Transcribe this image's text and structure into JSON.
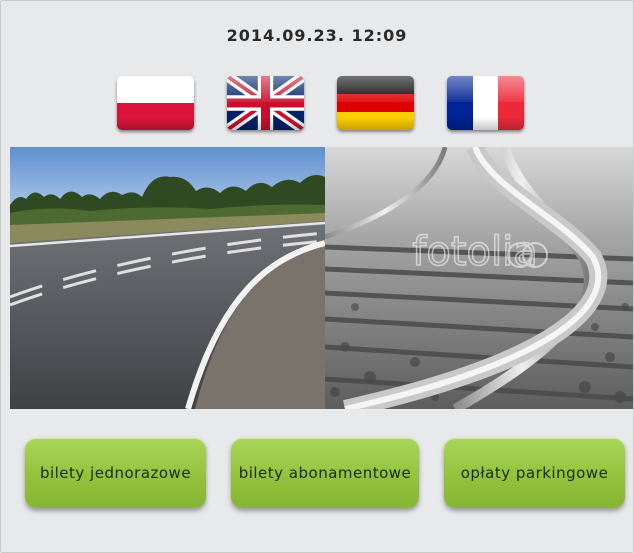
{
  "header": {
    "datetime": "2014.09.23. 12:09"
  },
  "languages": [
    {
      "code": "pl",
      "icon": "poland-flag-icon",
      "colors": [
        "#ffffff",
        "#dc143c"
      ]
    },
    {
      "code": "en",
      "icon": "uk-flag-icon",
      "colors": [
        "#012169",
        "#ffffff",
        "#c8102e"
      ]
    },
    {
      "code": "de",
      "icon": "germany-flag-icon",
      "colors": [
        "#000000",
        "#dd0000",
        "#ffce00"
      ]
    },
    {
      "code": "fr",
      "icon": "france-flag-icon",
      "colors": [
        "#002395",
        "#ffffff",
        "#ed2939"
      ]
    }
  ],
  "images": {
    "road": {
      "icon": "road-photo"
    },
    "rail": {
      "icon": "railway-photo",
      "watermark": "fotolia"
    }
  },
  "buttons": {
    "single_tickets": "bilety jednorazowe",
    "season_tickets": "bilety abonamentowe",
    "parking_fees": "opłaty parkingowe"
  },
  "colors": {
    "button_green": "#93c33c",
    "background": "#e8e9ea"
  }
}
